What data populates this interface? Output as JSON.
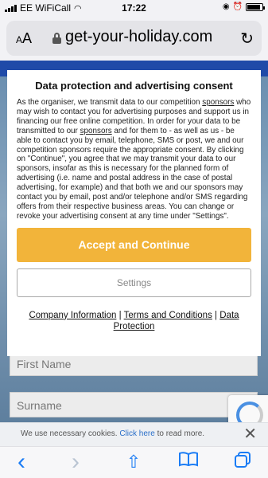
{
  "status": {
    "carrier": "EE WiFiCall",
    "time": "17:22",
    "battery_level": 0.9
  },
  "browser": {
    "text_size_label": "AA",
    "domain": "get-your-holiday.com"
  },
  "form": {
    "first_name_placeholder": "First Name",
    "surname_placeholder": "Surname"
  },
  "modal": {
    "title": "Data protection and advertising consent",
    "body": {
      "t1": "As the organiser, we transmit data to our competition ",
      "l1": "sponsors",
      "t2": " who may wish to contact you for advertising purposes and support us in financing our free online competition. In order for your data to be transmitted to our ",
      "l2": "sponsors",
      "t3": " and for them to - as well as us - be able to contact you by email, telephone, SMS or post, we and our competition sponsors require the appropriate consent. By clicking on \"Continue\", you agree that we may transmit your data to our sponsors, insofar as this is necessary for the planned form of advertising (i.e. name and postal address in the case of postal advertising, for example) and that both we and our sponsors may contact you by email, post and/or telephone and/or SMS regarding offers from their respective business areas. You can change or revoke your advertising consent at any time under \"Settings\"."
    },
    "accept_label": "Accept and Continue",
    "settings_label": "Settings",
    "links": {
      "company": "Company Information",
      "terms": "Terms and Conditions",
      "privacy": "Data Protection",
      "separator": "|"
    }
  },
  "cookie": {
    "text": "We use necessary cookies. ",
    "link": "Click here",
    "text_after": " to read more.",
    "close": "✕"
  },
  "toolbar": {
    "back": "‹",
    "forward": "›",
    "share": "⇧",
    "bookmarks": "📖",
    "tabs": "❐"
  }
}
